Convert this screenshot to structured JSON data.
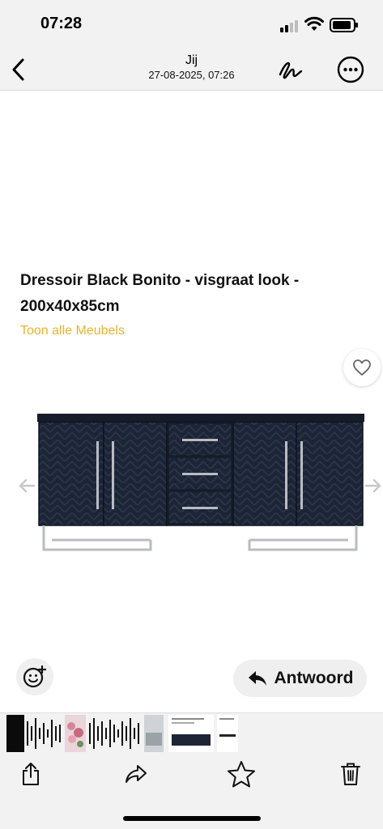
{
  "status_bar": {
    "time": "07:28",
    "signal_bars_active": 2,
    "signal_bars_total": 4,
    "icons": [
      "signal-icon",
      "wifi-icon",
      "battery-icon"
    ]
  },
  "nav": {
    "title": "Jij",
    "subtitle": "27-08-2025, 07:26",
    "icons": [
      "chevron-left-icon",
      "markup-pen-icon",
      "more-icon"
    ]
  },
  "product": {
    "title": "Dressoir Black Bonito - visgraat look - 200x40x85cm",
    "link": "Toon alle Meubels",
    "link_color": "#e9b32a"
  },
  "actions": {
    "reply_label": "Antwoord",
    "icons": [
      "emoji-add-icon",
      "reply-arrow-icon",
      "heart-icon",
      "arrow-left-icon",
      "arrow-right-icon"
    ]
  },
  "toolbar": {
    "icons": [
      "share-icon",
      "forward-icon",
      "star-icon",
      "trash-icon"
    ]
  },
  "colors": {
    "chrome_bg": "#f2f2f2",
    "accent_link": "#e9b32a",
    "sideboard": "#1b2233"
  }
}
